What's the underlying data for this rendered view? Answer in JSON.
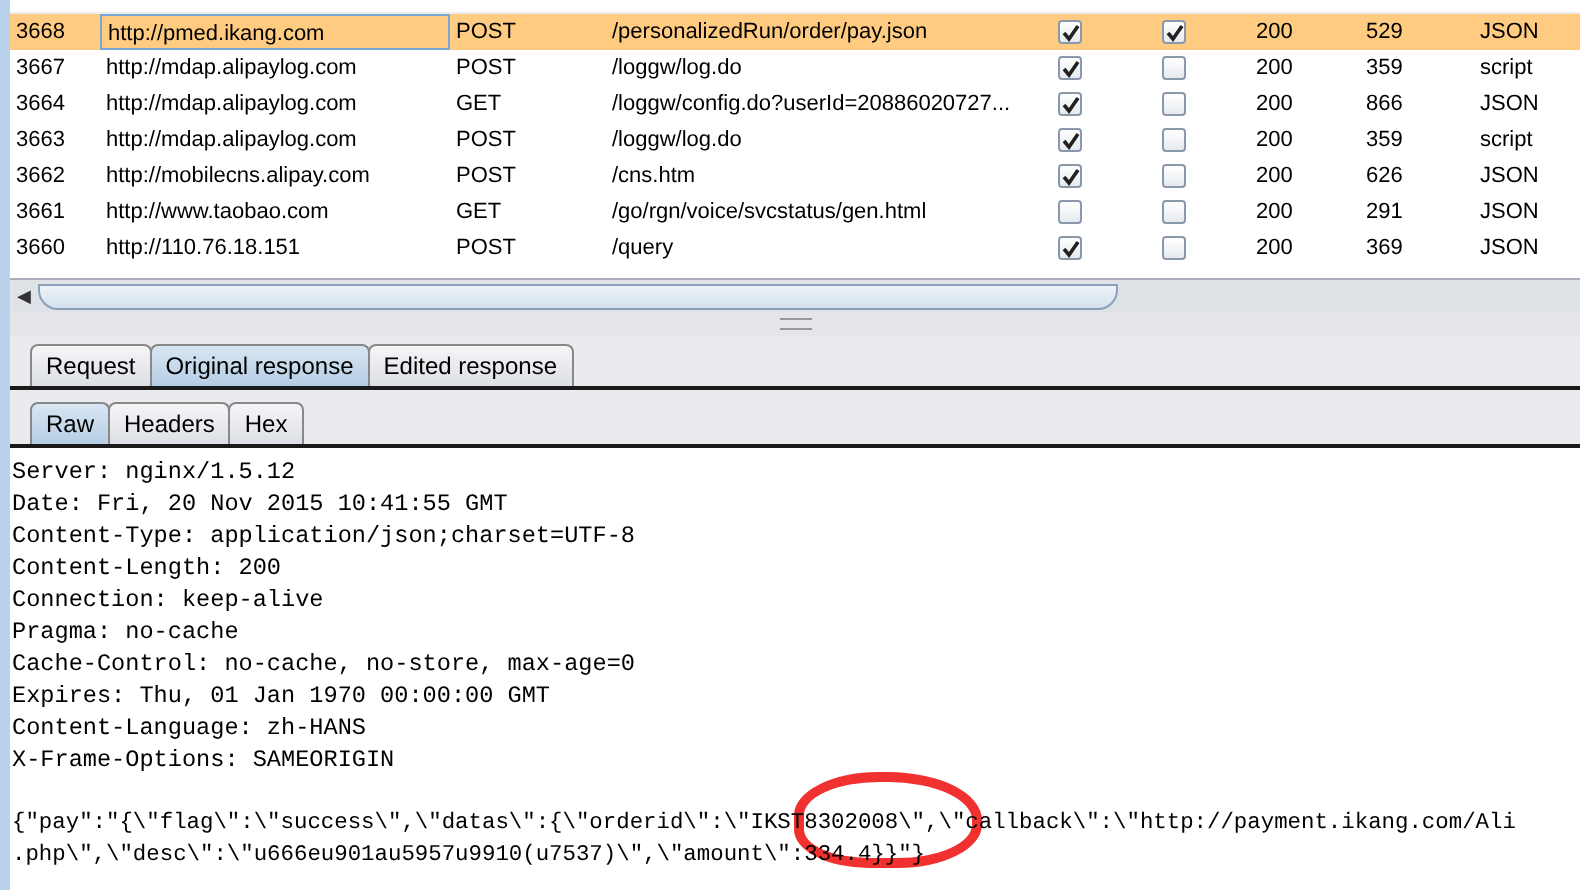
{
  "table": {
    "rows": [
      {
        "id": "3668",
        "host": "http://pmed.ikang.com",
        "method": "POST",
        "url": "/personalizedRun/order/pay.json",
        "checks": [
          true,
          true
        ],
        "status": "200",
        "length": "529",
        "mime": "JSON",
        "selected": true
      },
      {
        "id": "3667",
        "host": "http://mdap.alipaylog.com",
        "method": "POST",
        "url": "/loggw/log.do",
        "checks": [
          true,
          false
        ],
        "status": "200",
        "length": "359",
        "mime": "script",
        "selected": false
      },
      {
        "id": "3664",
        "host": "http://mdap.alipaylog.com",
        "method": "GET",
        "url": "/loggw/config.do?userId=20886020727...",
        "checks": [
          true,
          false
        ],
        "status": "200",
        "length": "866",
        "mime": "JSON",
        "selected": false
      },
      {
        "id": "3663",
        "host": "http://mdap.alipaylog.com",
        "method": "POST",
        "url": "/loggw/log.do",
        "checks": [
          true,
          false
        ],
        "status": "200",
        "length": "359",
        "mime": "script",
        "selected": false
      },
      {
        "id": "3662",
        "host": "http://mobilecns.alipay.com",
        "method": "POST",
        "url": "/cns.htm",
        "checks": [
          true,
          false
        ],
        "status": "200",
        "length": "626",
        "mime": "JSON",
        "selected": false
      },
      {
        "id": "3661",
        "host": "http://www.taobao.com",
        "method": "GET",
        "url": "/go/rgn/voice/svcstatus/gen.html",
        "checks": [
          false,
          false
        ],
        "status": "200",
        "length": "291",
        "mime": "JSON",
        "selected": false
      },
      {
        "id": "3660",
        "host": "http://110.76.18.151",
        "method": "POST",
        "url": "/query",
        "checks": [
          true,
          false
        ],
        "status": "200",
        "length": "369",
        "mime": "JSON",
        "selected": false
      }
    ]
  },
  "scroll_arrow": "◀",
  "tabs": [
    {
      "label": "Request",
      "selected": false
    },
    {
      "label": "Original response",
      "selected": true
    },
    {
      "label": "Edited response",
      "selected": false
    }
  ],
  "subtabs": [
    {
      "label": "Raw",
      "selected": true
    },
    {
      "label": "Headers",
      "selected": false
    },
    {
      "label": "Hex",
      "selected": false
    }
  ],
  "response_lines": [
    "Server: nginx/1.5.12",
    "Date: Fri, 20 Nov 2015 10:41:55 GMT",
    "Content-Type: application/json;charset=UTF-8",
    "Content-Length: 200",
    "Connection: keep-alive",
    "Pragma: no-cache",
    "Cache-Control: no-cache, no-store, max-age=0",
    "Expires: Thu, 01 Jan 1970 00:00:00 GMT",
    "Content-Language: zh-HANS",
    "X-Frame-Options: SAMEORIGIN"
  ],
  "body_lines": [
    "{\"pay\":\"{\\\"flag\\\":\\\"success\\\",\\\"datas\\\":{\\\"orderid\\\":\\\"IKST8302008\\\",\\\"callback\\\":\\\"http://payment.ikang.com/Ali",
    ".php\\\",\\\"desc\\\":\\\"u666eu901au5957u9910(u7537)\\\",\\\"amount\\\":334.4}}\"}"
  ]
}
